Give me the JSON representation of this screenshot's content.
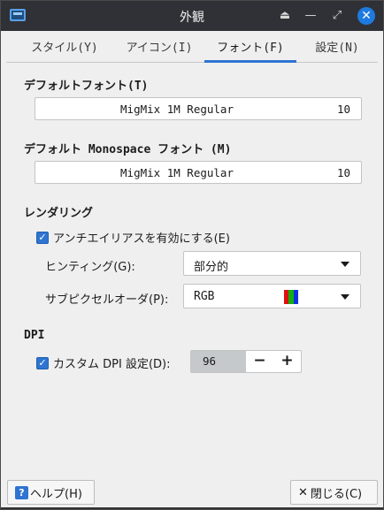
{
  "window": {
    "title": "外観"
  },
  "tabs": [
    {
      "label": "スタイル(Y)",
      "active": false
    },
    {
      "label": "アイコン(I)",
      "active": false
    },
    {
      "label": "フォント(F)",
      "active": true
    },
    {
      "label": "設定(N)",
      "active": false
    }
  ],
  "default_font": {
    "heading": "デフォルトフォント(T)",
    "name": "MigMix 1M Regular",
    "size": "10"
  },
  "mono_font": {
    "heading": "デフォルト Monospace フォント (M)",
    "name": "MigMix 1M Regular",
    "size": "10"
  },
  "rendering": {
    "heading": "レンダリング",
    "antialias_label": "アンチエイリアスを有効にする(E)",
    "antialias_checked": true,
    "hinting_label": "ヒンティング(G):",
    "hinting_value": "部分的",
    "subpixel_label": "サブピクセルオーダ(P):",
    "subpixel_value": "RGB"
  },
  "dpi": {
    "heading": "DPI",
    "custom_label": "カスタム DPI 設定(D):",
    "custom_checked": true,
    "value": "96",
    "minus": "−",
    "plus": "+"
  },
  "buttons": {
    "help": "ヘルプ(H)",
    "close": "閉じる(C)"
  },
  "colors": {
    "accent": "#2f74d0",
    "titlebar": "#2f3136",
    "close_button": "#1e7ae0"
  }
}
